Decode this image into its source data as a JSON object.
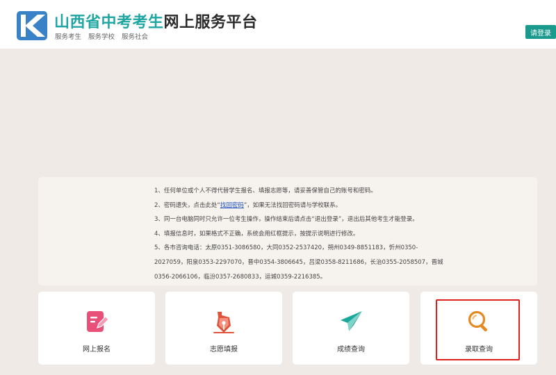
{
  "header": {
    "title_highlight": "山西省中考考生",
    "title_rest": "网上服务平台",
    "subtitle": [
      "服务考生",
      "服务学校",
      "服务社会"
    ],
    "login_label": "请登录"
  },
  "notice": {
    "line1": "1、任何单位或个人不得代替学生报名、填报志愿等，请妥善保管自己的账号和密码。",
    "line2_pre": "2、密码遗失，点击此处“",
    "line2_link": "找回密码",
    "line2_post": "”，如果无法找回密码请与学校联系。",
    "line3": "3、同一台电脑同时只允许一位考生操作，操作结束后请点击“退出登录”，退出后其他考生才能登录。",
    "line4": "4、填报信息时，如果格式不正确，系统会用红框提示，按提示说明进行修改。",
    "line5": "5、各市咨询电话：太原0351-3086580，大同0352-2537420，朔州0349-8851183，忻州0350-",
    "line6": "2027059，阳泉0353-2297070，晋中0354-3806645，吕梁0358-8211686，长治0355-2058507，晋城",
    "line7": "0356-2066106，临汾0357-2680833，运城0359-2216385。"
  },
  "cards": [
    {
      "label": "网上报名",
      "icon": "edit-document-icon",
      "color": "#e8507a"
    },
    {
      "label": "志愿填报",
      "icon": "pen-nib-icon",
      "color": "#e0533a"
    },
    {
      "label": "成绩查询",
      "icon": "paper-plane-icon",
      "color": "#1aa89a"
    },
    {
      "label": "录取查询",
      "icon": "search-icon",
      "color": "#e58a22"
    }
  ]
}
